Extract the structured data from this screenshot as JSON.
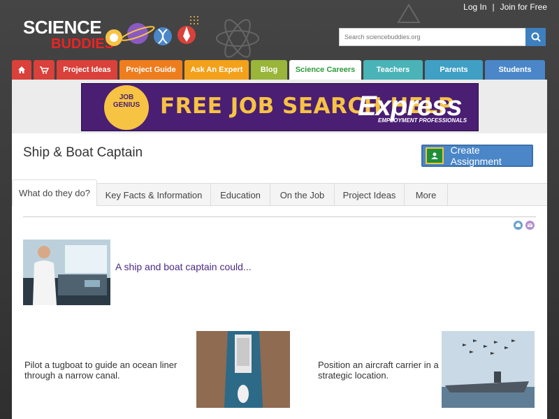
{
  "header": {
    "login": "Log In",
    "separator": "|",
    "join": "Join for Free",
    "logo_line1": "SCIENCE",
    "logo_line2": "BUDDIES"
  },
  "search": {
    "placeholder": "Search sciencebuddies.org"
  },
  "nav": {
    "tabs": [
      {
        "label": "",
        "icon": "home-icon",
        "color": "#d9413a"
      },
      {
        "label": "",
        "icon": "cart-icon",
        "color": "#d9413a"
      },
      {
        "label": "Project Ideas",
        "color": "#d9413a"
      },
      {
        "label": "Project Guide",
        "color": "#ee7d1e"
      },
      {
        "label": "Ask An Expert",
        "color": "#f3a11a"
      },
      {
        "label": "Blog",
        "color": "#99b53a"
      },
      {
        "label": "Science Careers",
        "color": "#ffffff",
        "text_color": "#2e9a3c",
        "active": true
      },
      {
        "label": "Teachers",
        "color": "#49b3b8"
      },
      {
        "label": "Parents",
        "color": "#3f9fc4"
      },
      {
        "label": "Students",
        "color": "#4a86c8"
      }
    ]
  },
  "ad": {
    "badge": "JOB GENIUS",
    "promo": "FREE JOB SEARCH HELP",
    "brand": "Express",
    "brand_sub": "EMPLOYMENT PROFESSIONALS"
  },
  "page": {
    "title": "Ship & Boat Captain",
    "assign_label": "Create Assignment"
  },
  "subtabs": [
    {
      "label": "What do they do?",
      "active": true
    },
    {
      "label": "Key Facts & Information"
    },
    {
      "label": "Education"
    },
    {
      "label": "On the Job"
    },
    {
      "label": "Project Ideas"
    },
    {
      "label": "More"
    }
  ],
  "lead": {
    "text": "A ship and boat captain could..."
  },
  "items": [
    {
      "text_line1": "Pilot a tugboat to guide an ocean liner",
      "text_line2": "through a narrow canal."
    },
    {
      "text_line1": "Position an aircraft carrier in a",
      "text_line2": "strategic location."
    }
  ],
  "colors": {
    "accent": "#4a86c8",
    "link": "#4b2a82"
  }
}
